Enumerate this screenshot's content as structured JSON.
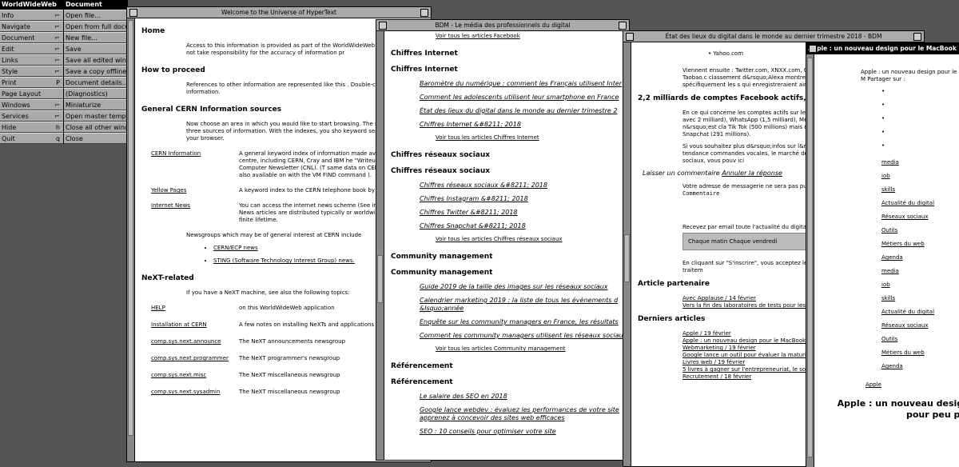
{
  "menu1": {
    "title": "WorldWideWeb",
    "items": [
      {
        "label": "Info",
        "key": "⌐"
      },
      {
        "label": "Navigate",
        "key": "⌐"
      },
      {
        "label": "Document",
        "key": "⌐"
      },
      {
        "label": "Edit",
        "key": "⌐"
      },
      {
        "label": "Links",
        "key": "⌐"
      },
      {
        "label": "Style",
        "key": "⌐"
      },
      {
        "label": "Print",
        "key": "P"
      },
      {
        "label": "Page Layout",
        "key": ""
      },
      {
        "label": "Windows",
        "key": "⌐"
      },
      {
        "label": "Services",
        "key": "⌐"
      },
      {
        "label": "Hide",
        "key": "h"
      },
      {
        "label": "Quit",
        "key": "q"
      }
    ]
  },
  "menu2": {
    "title": "Document",
    "items": [
      {
        "label": "Open file..."
      },
      {
        "label": "Open from full docum"
      },
      {
        "label": "New file..."
      },
      {
        "label": "Save"
      },
      {
        "label": "Save all edited windo"
      },
      {
        "label": "Save a copy offline"
      },
      {
        "label": "Document details..."
      },
      {
        "label": "(Diagnostics)"
      },
      {
        "label": "Miniaturize"
      },
      {
        "label": "Open master template"
      },
      {
        "label": "Close all other windo"
      },
      {
        "label": "Close"
      }
    ]
  },
  "win1": {
    "title": "Welcome to the Universe of HyperText",
    "home_h": "Home",
    "home_p": "Access to this information is provided as part of the WorldWideWeb pr project does not take responsibility for the accuracy of information pr",
    "proceed_h": "How to proceed",
    "proceed_p": "References to other information are represented like this . Double-click related information.",
    "cern_h": "General CERN Information sources",
    "cern_p": "Now choose an area in which you would like to start browsing. The s has access to three sources of information. With the indexes, you sho keyword search option on your browser.",
    "rows": [
      {
        "k": "CERN Information",
        "v": "A general keyword index of information made avai computer centre, including CERN, Cray and IBM he \"Writeups\", and the Computer Newsletter (CNL). (T same data on CERNVM which is also available on with the VM FIND command )."
      },
      {
        "k": "Yellow Pages",
        "v": "A keyword index to the CERN telephone book by f"
      },
      {
        "k": "Internet News",
        "v": "You can access the internet news scheme (See in new users ). News articles are distributed typically or worldwide, and have a finite lifetime."
      }
    ],
    "news_p": "Newsgroups which may be of general interest at CERN include",
    "bullets": [
      "CERN/ECP news",
      "STING (Software Technology Interest Group) news."
    ],
    "next_h": "NeXT-related",
    "next_p": "If you have a NeXT machine, see also the following topics:",
    "next_rows": [
      {
        "k": "HELP",
        "v": "on this WorldWideWeb application"
      },
      {
        "k": "Installation at CERN",
        "v": "A few notes on installing NeXTs and applications a"
      },
      {
        "k": "comp.sys.next.announce",
        "v": "The NeXT announcements newsgroup"
      },
      {
        "k": "comp.sys.next.programmer",
        "v": "The NeXT programmer's newsgroup"
      },
      {
        "k": "comp.sys.next.misc",
        "v": "The NeXT miscellaneous newsgroup"
      },
      {
        "k": "comp.sys.next.sysadmin",
        "v": "The NeXT miscellaneous newsgroup"
      }
    ]
  },
  "win2": {
    "title": "BDM - Le média des professionnels du digital",
    "top_link": "Voir tous les articles Facebook",
    "sections": [
      {
        "h1": "Chiffres Internet",
        "h2": "Chiffres Internet",
        "items": [
          "Baromètre du numérique : comment les Français utilisent Inter",
          "Comment les adolescents utilisent leur smartphone en France",
          "État des lieux du digital dans le monde au dernier trimestre 2",
          "Chiffres Internet &#8211; 2018"
        ],
        "more": "Voir tous les articles Chiffres Internet"
      },
      {
        "h1": "Chiffres réseaux sociaux",
        "h2": "Chiffres réseaux sociaux",
        "items": [
          "Chiffres réseaux sociaux &#8211; 2018",
          "Chiffres Instagram &#8211; 2018",
          "Chiffres Twitter &#8211; 2018",
          "Chiffres Snapchat &#8211; 2018"
        ],
        "more": "Voir tous les articles Chiffres réseaux sociaux"
      },
      {
        "h1": "Community management",
        "h2": "Community management",
        "items": [
          "Guide 2019 de la taille des images sur les réseaux sociaux",
          "Calendrier marketing 2019 : la liste de tous les évènements d &lsquo;année",
          "Enquête sur les community managers en France, les résultats",
          "Comment les community managers utilisent les réseaux sociau"
        ],
        "more": "Voir tous les articles Community management"
      },
      {
        "h1": "Référencement",
        "h2": "Référencement",
        "items": [
          "Le salaire des SEO en 2018",
          "Google lance webdev : évaluez les performances de votre site apprenez à concevoir des sites web efficaces",
          "SEO : 10 conseils pour optimiser votre site"
        ],
        "more": ""
      }
    ]
  },
  "win3": {
    "title": "État des lieux du digital dans le monde au dernier trimestre 2018 - BDM",
    "yahoo": "Yahoo.com",
    "p1": "Viennent ensuite : Twitter.com, XNXX.com, G SimilarWeb, et QQ.com, Tmall.com, Taobao.c classement d&rsquo;Alexa montre bien la pro sources de trafic, et plus spécifiquement les s qui enregistreraient ainsi plus de trafic qu&rso",
    "h_fb": "2,2 milliards de comptes Facebook actifs, 1,9 pour",
    "p2": "En ce qui concerne les comptes actifs sur les classe sans surprise Facebook en tête avec 2 milliard), WhatsApp (1,5 milliard), Messenger Instagram (1 milliard). Twitter n&rsquo;est cla Tik Tok (500 millions) mais devant Reddit (330 (300 millions) et Snapchat (291 millions).",
    "p3": "Si vous souhaitez plus d&rsquo;infos sur l&rsq afin d&rsquo;en savoir plus sur : les tendance commandes vocales, le marché des applicatio poussées sur les réseaux sociaux, vous pouv ici",
    "comment_l": "Laisser un commentaire",
    "comment_cancel": "Annuler la réponse",
    "p4": "Votre adresse de messagerie ne sera pas publ indiqués avec *",
    "comment_label": "Commentaire",
    "newsletter": "Recevez par email toute l'actualité du digital",
    "newsletter_opts": "Chaque matin Chaque vendredi",
    "p5": "En cliquant sur \"S'inscrire\", vous acceptez le confidentialité décrivant la finalité des traitem",
    "partner_h": "Article partenaire",
    "partner_1": "Avec Applause / 14 février",
    "partner_2": "Vers la fin des laboratoires de tests pour les l",
    "latest_h": "Derniers articles",
    "latest": [
      "Apple / 19 février",
      "Apple : un nouveau design pour le MacBook",
      "Webmarketing / 19 février",
      "Google lance un outil pour évaluer la maturité",
      "Livres web / 19 février",
      "5 livres à gagner sur l'entrepreneuriat, le soci",
      "Recrutement / 18 février"
    ]
  },
  "win4": {
    "title": "Apple : un nouveau design pour le MacBook P",
    "intro": "Apple : un nouveau design pour le M Partager sur :",
    "links": [
      "media",
      "iob",
      "skills",
      "Actualité du digital",
      "Réseaux sociaux",
      "Outils",
      "Métiers du web",
      "Agenda",
      "media",
      "iob",
      "skills",
      "Actualité du digital",
      "Réseaux sociaux",
      "Outils",
      "Métiers du web",
      "Agenda"
    ],
    "apple_link": "Apple",
    "big_title": "Apple : un nouveau design pour peu plu"
  }
}
